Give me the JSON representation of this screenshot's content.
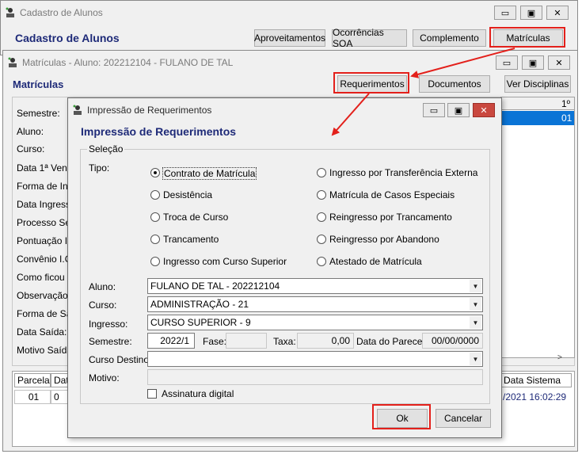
{
  "win1": {
    "title": "Cadastro de Alunos",
    "heading": "Cadastro de Alunos",
    "buttons": [
      "Aproveitamentos",
      "Ocorrências SOA",
      "Complemento",
      "Matrículas"
    ]
  },
  "win2": {
    "title": "Matrículas - Aluno: 202212104 - FULANO DE TAL",
    "heading": "Matrículas",
    "buttons": [
      "Requerimentos",
      "Documentos",
      "Ver Disciplinas"
    ],
    "labels": [
      "Semestre:",
      "Aluno:",
      "Curso:",
      "Data 1ª Venc",
      "Forma de Ingr",
      "Data Ingresso",
      "Processo Sel",
      "Pontuação In",
      "Convênio I.C.",
      "Como ficou S",
      "Observação:",
      "Forma de Saí",
      "Data Saída:",
      "Motivo Saída"
    ],
    "grid_header_right": "1º",
    "grid_row_right": "01",
    "bottom_grid": {
      "headers": [
        "Parcela",
        "Dat"
      ],
      "row": [
        "01",
        "0"
      ],
      "right_header": "Data Sistema",
      "right_value": "/2021 16:02:29"
    }
  },
  "dialog": {
    "title": "Impressão de Requerimentos",
    "heading": "Impressão de Requerimentos",
    "group_label": "Seleção",
    "tipo_label": "Tipo:",
    "radio_left": [
      "Contrato de Matrícula",
      "Desistência",
      "Troca de Curso",
      "Trancamento",
      "Ingresso com Curso Superior"
    ],
    "radio_right": [
      "Ingresso por Transferência Externa",
      "Matrícula de Casos Especiais",
      "Reingresso por Trancamento",
      "Reingresso por Abandono",
      "Atestado de Matrícula"
    ],
    "selected_radio": "Contrato de Matrícula",
    "fields": {
      "aluno_label": "Aluno:",
      "aluno_value": "FULANO DE TAL - 202212104",
      "curso_label": "Curso:",
      "curso_value": "ADMINISTRAÇÃO - 21",
      "ingresso_label": "Ingresso:",
      "ingresso_value": "CURSO SUPERIOR - 9",
      "semestre_label": "Semestre:",
      "semestre_value": "2022/1",
      "fase_label": "Fase:",
      "fase_value": "",
      "taxa_label": "Taxa:",
      "taxa_value": "0,00",
      "parecer_label": "Data do Parecer:",
      "parecer_value": "00/00/0000",
      "curso_destino_label": "Curso Destino:",
      "curso_destino_value": "",
      "motivo_label": "Motivo:",
      "motivo_value": ""
    },
    "checkbox_label": "Assinatura digital",
    "ok_label": "Ok",
    "cancel_label": "Cancelar"
  },
  "colors": {
    "accent": "#1e2a78",
    "highlight": "#e3201b",
    "selection": "#0a74d6"
  }
}
